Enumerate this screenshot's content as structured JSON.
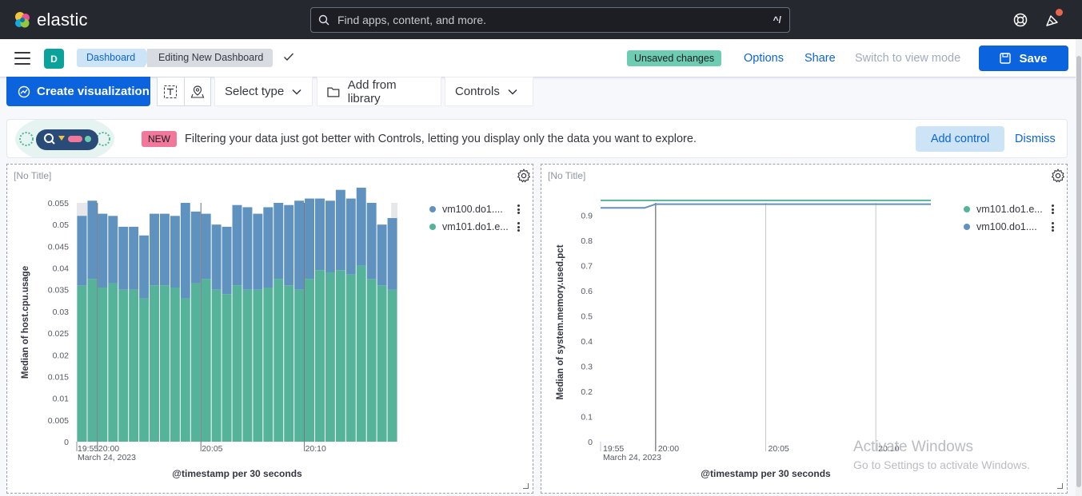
{
  "header": {
    "brand": "elastic",
    "search_placeholder": "Find apps, content, and more.",
    "search_shortcut": "^/"
  },
  "subheader": {
    "avatar_letter": "D",
    "breadcrumbs": [
      "Dashboard",
      "Editing New Dashboard"
    ],
    "unsaved_badge": "Unsaved changes",
    "options": "Options",
    "share": "Share",
    "switch_mode": "Switch to view mode",
    "save": "Save"
  },
  "toolbar": {
    "create_visualization": "Create visualization",
    "select_type": "Select type",
    "add_from_library": "Add from library",
    "controls": "Controls"
  },
  "callout": {
    "badge": "NEW",
    "message": "Filtering your data just got better with Controls, letting you display only the data you want to explore.",
    "add_control": "Add control",
    "dismiss": "Dismiss"
  },
  "panels": [
    {
      "title": "[No Title]",
      "legend": [
        "vm100.do1....",
        "vm101.do1.e..."
      ]
    },
    {
      "title": "[No Title]",
      "legend": [
        "vm101.do1.e...",
        "vm100.do1...."
      ]
    }
  ],
  "colors": {
    "series_blue": "#6092c0",
    "series_green": "#54b399",
    "accent": "#0b64dd"
  },
  "watermark": {
    "line1": "Activate Windows",
    "line2": "Go to Settings to activate Windows."
  },
  "chart_data": [
    {
      "type": "bar",
      "stacked": true,
      "xlabel": "@timestamp per 30 seconds",
      "ylabel": "Median of host.cpu.usage",
      "ylim": [
        0,
        0.055
      ],
      "yticks": [
        "0.055",
        "0.05",
        "0.045",
        "0.04",
        "0.035",
        "0.03",
        "0.025",
        "0.02",
        "0.015",
        "0.01",
        "0.005",
        "0"
      ],
      "xticks": [
        "19:55",
        "20:00",
        "20:05",
        "20:10"
      ],
      "date_label": "March 24, 2023",
      "series": [
        {
          "name": "vm101.do1.e...",
          "color": "#54b399",
          "values": [
            0.036,
            0.0375,
            0.0355,
            0.0365,
            0.035,
            0.035,
            0.033,
            0.036,
            0.036,
            0.0355,
            0.033,
            0.0365,
            0.0375,
            0.035,
            0.034,
            0.036,
            0.035,
            0.035,
            0.0355,
            0.0375,
            0.036,
            0.035,
            0.0375,
            0.0395,
            0.039,
            0.0395,
            0.0385,
            0.0405,
            0.0375,
            0.036,
            0.035
          ]
        },
        {
          "name": "vm100.do1....",
          "color": "#6092c0",
          "values": [
            0.016,
            0.018,
            0.017,
            0.0155,
            0.0145,
            0.0145,
            0.0145,
            0.0165,
            0.0165,
            0.0165,
            0.022,
            0.0165,
            0.015,
            0.015,
            0.0155,
            0.0185,
            0.019,
            0.0175,
            0.0185,
            0.0175,
            0.0185,
            0.0205,
            0.0185,
            0.0165,
            0.0165,
            0.0185,
            0.0175,
            0.018,
            0.0175,
            0.014,
            0.0165
          ]
        }
      ]
    },
    {
      "type": "line",
      "xlabel": "@timestamp per 30 seconds",
      "ylabel": "Median of system.memory.used.pct",
      "ylim": [
        0,
        0.95
      ],
      "yticks": [
        "0.9",
        "0.8",
        "0.7",
        "0.6",
        "0.5",
        "0.4",
        "0.3",
        "0.2",
        "0.1",
        "0"
      ],
      "xticks": [
        "19:55",
        "20:00",
        "20:05",
        "20:10"
      ],
      "date_label": "March 24, 2023",
      "series": [
        {
          "name": "vm101.do1.e...",
          "color": "#54b399",
          "values": [
            0.96,
            0.96,
            0.96,
            0.96,
            0.96,
            0.96,
            0.96,
            0.96,
            0.96,
            0.96,
            0.96,
            0.96,
            0.96,
            0.96,
            0.96,
            0.96,
            0.96,
            0.96,
            0.96,
            0.96,
            0.96,
            0.96,
            0.96,
            0.96,
            0.96,
            0.96,
            0.96,
            0.96,
            0.96,
            0.96,
            0.96
          ]
        },
        {
          "name": "vm100.do1....",
          "color": "#6092c0",
          "values": [
            0.93,
            0.93,
            0.93,
            0.93,
            0.93,
            0.945,
            0.945,
            0.945,
            0.945,
            0.945,
            0.945,
            0.945,
            0.945,
            0.945,
            0.945,
            0.945,
            0.945,
            0.945,
            0.945,
            0.945,
            0.945,
            0.945,
            0.945,
            0.945,
            0.945,
            0.945,
            0.945,
            0.945,
            0.945,
            0.945,
            0.945
          ]
        }
      ]
    }
  ]
}
